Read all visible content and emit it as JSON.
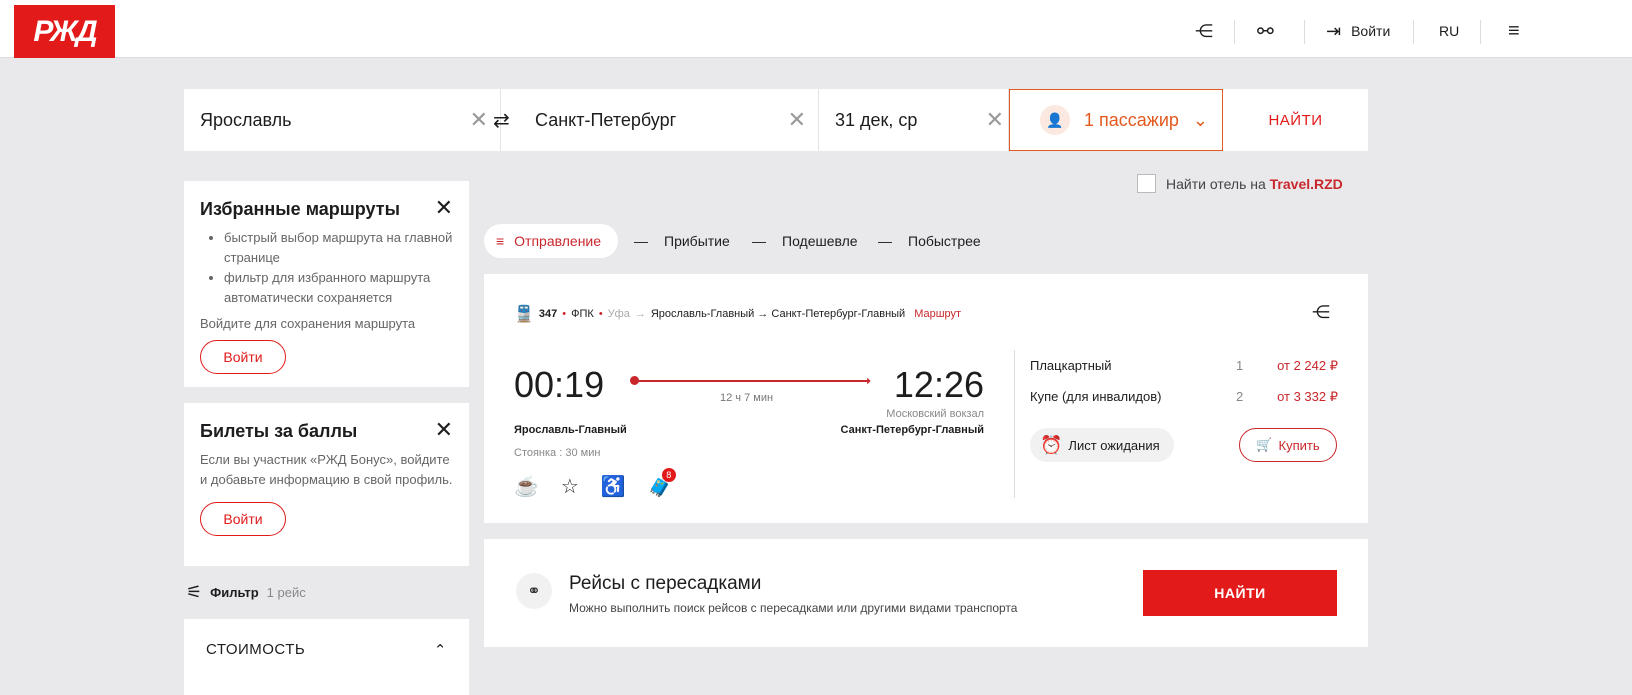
{
  "header": {
    "logo": "РЖД",
    "login": "Войти",
    "lang": "RU"
  },
  "search": {
    "from": "Ярославль",
    "to": "Санкт-Петербург",
    "date": "31 дек, ср",
    "passengers": "1 пассажир",
    "find": "НАЙТИ"
  },
  "hotel": {
    "label": "Найти отель на ",
    "link": "Travel.RZD"
  },
  "favorites": {
    "title": "Избранные маршруты",
    "items": [
      "быстрый выбор маршрута на главной странице",
      "фильтр для избранного маршрута автоматически сохраняется"
    ],
    "note": "Войдите для сохранения маршрута",
    "button": "Войти"
  },
  "points": {
    "title": "Билеты за баллы",
    "text": "Если вы участник «РЖД Бонус», войдите и добавьте информацию в свой профиль.",
    "button": "Войти"
  },
  "filter": {
    "label": "Фильтр",
    "count": "1 рейс"
  },
  "cost": {
    "label": "СТОИМОСТЬ"
  },
  "sort": [
    "Отправление",
    "Прибытие",
    "Подешевле",
    "Побыстрее"
  ],
  "train": {
    "number": "347",
    "carrier": "ФПК",
    "origin": "Уфа",
    "route": "Ярославль-Главный → Санкт-Петербург-Главный",
    "route_link": "Маршрут",
    "dep_time": "00:19",
    "arr_time": "12:26",
    "duration": "12 ч 7 мин",
    "arr_station_name": "Московский вокзал",
    "dep_station": "Ярославль-Главный",
    "arr_station": "Санкт-Петербург-Главный",
    "stop": "Стоянка : 30 мин",
    "badge": "8",
    "classes": [
      {
        "name": "Плацкартный",
        "seats": "1",
        "price": "от 2 242 ₽"
      },
      {
        "name": "Купе (для инвалидов)",
        "seats": "2",
        "price": "от 3 332 ₽"
      }
    ],
    "waitlist": "Лист ожидания",
    "buy": "Купить"
  },
  "transfers": {
    "title": "Рейсы с пересадками",
    "text": "Можно выполнить поиск рейсов с пересадками или другими видами транспорта",
    "button": "НАЙТИ"
  }
}
